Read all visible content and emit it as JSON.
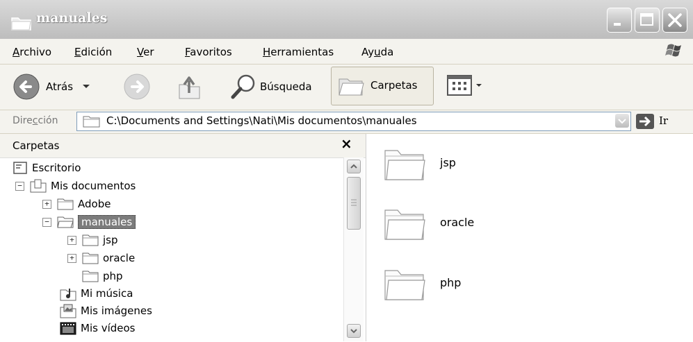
{
  "window": {
    "title": "manuales"
  },
  "menu": {
    "items": [
      {
        "prefix": "",
        "key": "A",
        "rest": "rchivo"
      },
      {
        "prefix": "",
        "key": "E",
        "rest": "dición"
      },
      {
        "prefix": "",
        "key": "V",
        "rest": "er"
      },
      {
        "prefix": "",
        "key": "F",
        "rest": "avoritos"
      },
      {
        "prefix": "",
        "key": "H",
        "rest": "erramientas"
      },
      {
        "prefix": "Ay",
        "key": "u",
        "rest": "da"
      }
    ]
  },
  "toolbar": {
    "back_label": "Atrás",
    "search_label": "Búsqueda",
    "folders_label": "Carpetas"
  },
  "address": {
    "label_pre": "Dire",
    "label_key": "c",
    "label_post": "ción",
    "value": "C:\\Documents and Settings\\Nati\\Mis documentos\\manuales",
    "go_label": "Ir"
  },
  "folders_pane": {
    "title": "Carpetas",
    "close_symbol": "×",
    "tree": {
      "escritorio": "Escritorio",
      "mis_documentos": "Mis documentos",
      "adobe": "Adobe",
      "manuales": "manuales",
      "jsp": "jsp",
      "oracle": "oracle",
      "php": "php",
      "mi_musica": "Mi música",
      "mis_imagenes": "Mis imágenes",
      "mis_videos": "Mis vídeos"
    }
  },
  "content": {
    "folders": [
      "jsp",
      "oracle",
      "php"
    ]
  },
  "colors": {
    "selection": "#7c7c7c",
    "address_border": "#7f9db9",
    "chrome": "#f4f3ee"
  }
}
